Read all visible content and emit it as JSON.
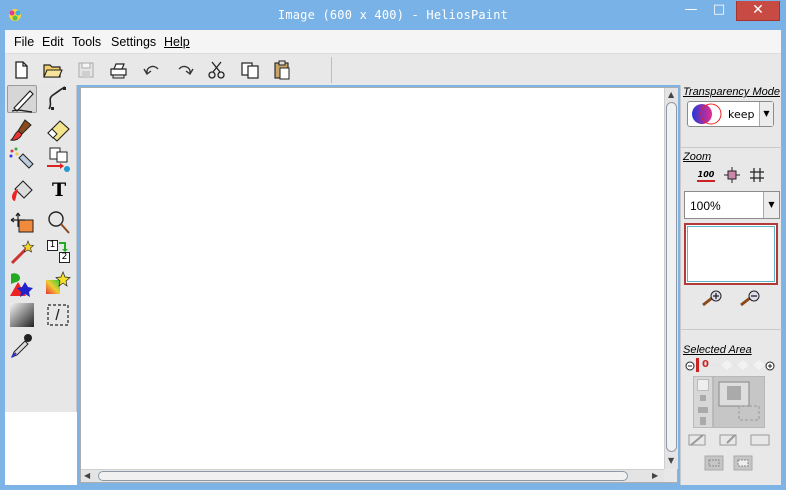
{
  "window": {
    "title": "Image (600 x 400) - HeliosPaint",
    "minimize": "—",
    "maximize": "□",
    "close": "✕"
  },
  "menu": [
    "File",
    "Edit",
    "Tools",
    "Settings",
    "Help"
  ],
  "toolbar": [
    "new-file-icon",
    "open-folder-icon",
    "save-icon",
    "print-icon",
    "undo-icon",
    "redo-icon",
    "cut-icon",
    "copy-icon",
    "paste-icon"
  ],
  "tools": {
    "column1": [
      "pencil-icon",
      "brush-icon",
      "spray-icon",
      "bucket-icon",
      "move-icon",
      "magic-wand-icon",
      "shapes-icon",
      "gradient-icon",
      "eyedropper-icon"
    ],
    "column2": [
      "curve-icon",
      "eraser-icon",
      "clone-icon",
      "text-icon",
      "lasso-icon",
      "layer-order-icon",
      "star-icon",
      "selection-icon"
    ],
    "text_tool_glyph": "T",
    "layer_order_glyphs": [
      "1",
      "2"
    ]
  },
  "right_panel": {
    "transparency_label": "Transparency Mode",
    "transparency_value": "keep",
    "zoom_label": "Zoom",
    "zoom_value": "100%",
    "zoom_button_100": "100",
    "selected_area_label": "Selected Area",
    "selected_area_value": "0"
  },
  "colors": {
    "titlebar": "#79b2e6",
    "close_button": "#c74a43",
    "panel_bg": "#e8e8e8",
    "canvas_bg": "#ffffff"
  }
}
